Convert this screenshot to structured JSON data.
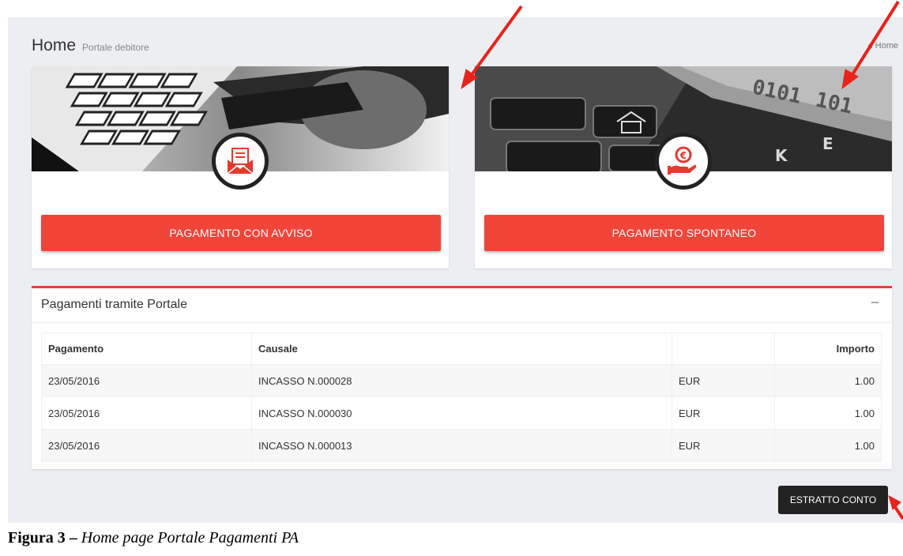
{
  "header": {
    "title": "Home",
    "subtitle": "Portale debitore",
    "breadcrumb": "Home"
  },
  "cards": [
    {
      "button_label": "PAGAMENTO CON AVVISO",
      "icon": "envelope-document-icon"
    },
    {
      "button_label": "PAGAMENTO SPONTANEO",
      "icon": "hand-euro-coin-icon"
    }
  ],
  "payments_box": {
    "title": "Pagamenti tramite Portale",
    "columns": [
      "Pagamento",
      "Causale",
      "",
      "Importo"
    ],
    "rows": [
      {
        "date": "23/05/2016",
        "causale": "INCASSO N.000028",
        "currency": "EUR",
        "amount": "1.00"
      },
      {
        "date": "23/05/2016",
        "causale": "INCASSO N.000030",
        "currency": "EUR",
        "amount": "1.00"
      },
      {
        "date": "23/05/2016",
        "causale": "INCASSO N.000013",
        "currency": "EUR",
        "amount": "1.00"
      }
    ]
  },
  "estratto_button": "ESTRATTO CONTO",
  "caption": {
    "label": "Figura 3 –",
    "text": " Home page Portale Pagamenti PA"
  },
  "colors": {
    "accent_red": "#f2453a",
    "annotation_arrow": "#e8231b",
    "dark_button": "#222222"
  }
}
